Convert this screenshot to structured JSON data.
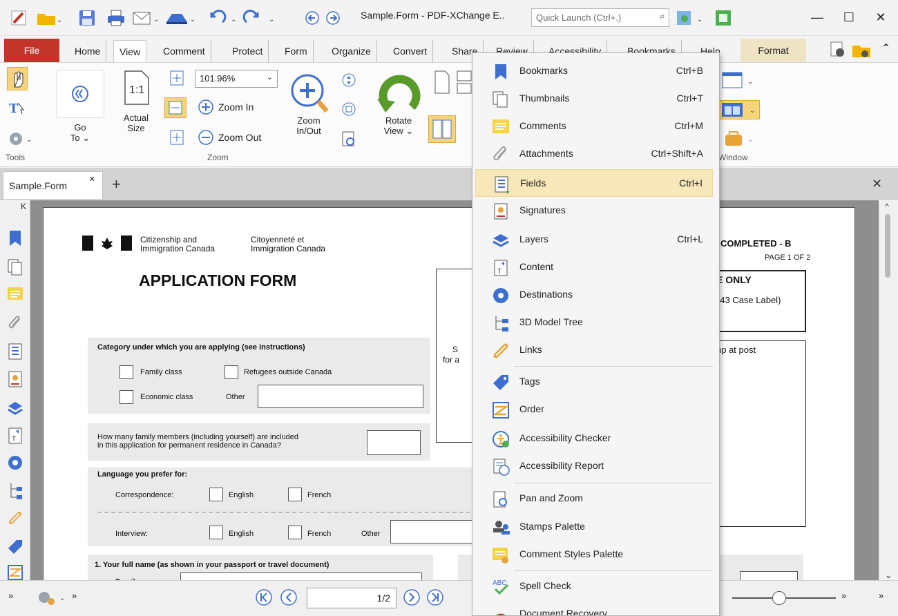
{
  "window": {
    "title": "Sample.Form - PDF-XChange E..",
    "quick_launch_placeholder": "Quick Launch (Ctrl+.)"
  },
  "menubar": {
    "file": "File",
    "tabs": [
      "Home",
      "View",
      "Comment",
      "Protect",
      "Form",
      "Organize",
      "Convert",
      "Share",
      "Review",
      "Accessibility",
      "Bookmarks",
      "Help"
    ],
    "format": "Format"
  },
  "ribbon": {
    "tools_label": "Tools",
    "go_to": "Go\nTo ⌄",
    "actual_size": "Actual\nSize",
    "zoom_value": "101.96%",
    "zoom_in": "Zoom In",
    "zoom_out": "Zoom Out",
    "zoom_inout": "Zoom\nIn/Out",
    "zoom_label": "Zoom",
    "rotate_view": "Rotate\nView ⌄",
    "window_label": "Window"
  },
  "doc_tab": {
    "name": "Sample.Form"
  },
  "document": {
    "agency_en": "Citizenship and\nImmigration Canada",
    "agency_fr": "Citoyenneté et\nImmigration Canada",
    "heading": "APPLICATION FORM",
    "completed": "COMPLETED - B",
    "page_of": "PAGE 1 OF 2",
    "use_only": "E ONLY",
    "case_label": "343 Case Label)",
    "stamp_post": "np at post",
    "category_label": "Category under which you are applying (see instructions)",
    "family_class": "Family class",
    "refugees": "Refugees outside Canada",
    "economic": "Economic class",
    "other": "Other",
    "members_q": "How many family members (including yourself) are included\nin this application for permanent residence in Canada?",
    "language_label": "Language you prefer for:",
    "correspondence": "Correspondence:",
    "english": "English",
    "french": "French",
    "interview": "Interview:",
    "full_name": "1.   Your full name (as shown in your passport or travel document)",
    "s_frag": "S",
    "for_frag": "for a",
    "family_name_frag": "Family name"
  },
  "statusbar": {
    "page_display": "1/2"
  },
  "menu": {
    "items": [
      {
        "label": "Bookmarks",
        "shortcut": "Ctrl+B"
      },
      {
        "label": "Thumbnails",
        "shortcut": "Ctrl+T"
      },
      {
        "label": "Comments",
        "shortcut": "Ctrl+M"
      },
      {
        "label": "Attachments",
        "shortcut": "Ctrl+Shift+A"
      },
      {
        "label": "Fields",
        "shortcut": "Ctrl+I"
      },
      {
        "label": "Signatures",
        "shortcut": ""
      },
      {
        "label": "Layers",
        "shortcut": "Ctrl+L"
      },
      {
        "label": "Content",
        "shortcut": ""
      },
      {
        "label": "Destinations",
        "shortcut": ""
      },
      {
        "label": "3D Model Tree",
        "shortcut": ""
      },
      {
        "label": "Links",
        "shortcut": ""
      },
      {
        "label": "Tags",
        "shortcut": ""
      },
      {
        "label": "Order",
        "shortcut": ""
      },
      {
        "label": "Accessibility Checker",
        "shortcut": ""
      },
      {
        "label": "Accessibility Report",
        "shortcut": ""
      },
      {
        "label": "Pan and Zoom",
        "shortcut": ""
      },
      {
        "label": "Stamps Palette",
        "shortcut": ""
      },
      {
        "label": "Comment Styles Palette",
        "shortcut": ""
      },
      {
        "label": "Spell Check",
        "shortcut": ""
      },
      {
        "label": "Document Recovery",
        "shortcut": ""
      }
    ]
  },
  "colors": {
    "file_tab": "#c2352b",
    "highlight": "#f8e7b8",
    "format_tab": "#eee4c4"
  }
}
